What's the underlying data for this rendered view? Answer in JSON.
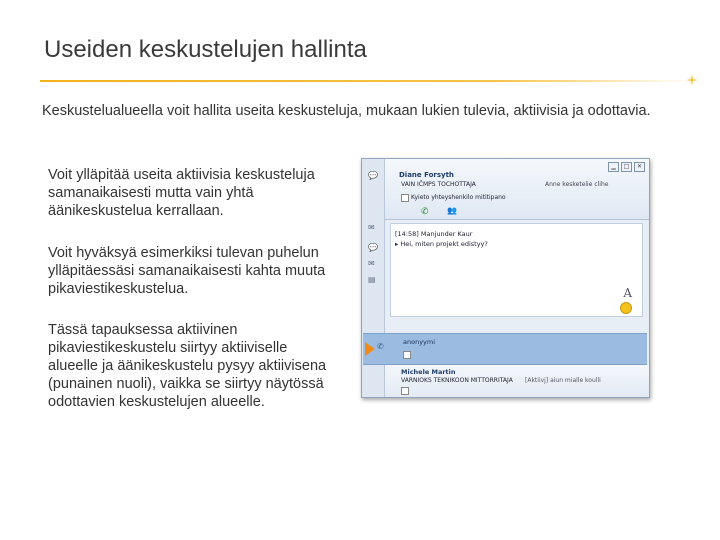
{
  "slide": {
    "title": "Useiden keskustelujen hallinta",
    "intro": "Keskustelualueella voit hallita useita keskusteluja, mukaan lukien tulevia, aktiivisia ja odottavia.",
    "paragraphs": [
      "Voit ylläpitää useita aktiivisia keskusteluja samanaikaisesti mutta vain yhtä äänikeskustelua kerrallaan.",
      "Voit hyväksyä esimerkiksi tulevan puhelun ylläpitäessäsi samanaikaisesti kahta muuta pikaviestikeskustelua.",
      "Tässä tapauksessa aktiivinen pikaviestikeskustelu siirtyy aktiiviselle alueelle ja äänikeskustelu pysyy aktiivisena (punainen nuoli), vaikka se siirtyy näytössä odottavien keskustelujen alueelle."
    ],
    "accent_color": "#f2b21a"
  },
  "screenshot": {
    "conversation1": {
      "name": "Diane Forsyth",
      "status": "VAIN IČMPS TOCHOTTAJA",
      "subject": "Kyieto yhteyshenkilo mititipano",
      "meta": "Anne kesketelie clihe"
    },
    "messages": [
      "[14:58] Manjunder Kaur",
      "▸ Hei, miten projekt edistyy?"
    ],
    "font_button": "A",
    "active_row": {
      "name": "anonyymi"
    },
    "waiting_row": {
      "name": "Michele Martin",
      "status": "VARNIOKS TEKNIKOON MITTORRITAJA",
      "meta": "[Aktiivj] aiun mialle koulli"
    },
    "window_controls": [
      "▁",
      "□",
      "✕"
    ]
  }
}
